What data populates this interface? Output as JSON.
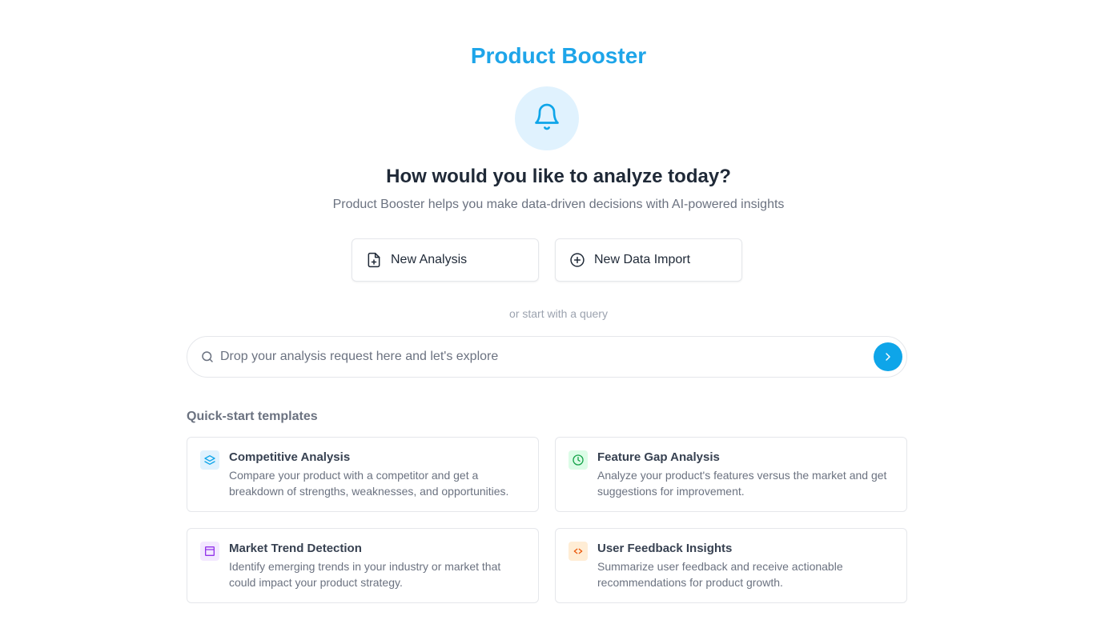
{
  "app": {
    "title": "Product Booster",
    "brand_color": "#1ea5e9"
  },
  "hero": {
    "icon": "bell-icon",
    "headline": "How would you like to analyze today?",
    "subtitle": "Product Booster helps you make data-driven decisions with AI-powered insights"
  },
  "actions": [
    {
      "label": "New Analysis",
      "icon": "file-plus-icon"
    },
    {
      "label": "New Data Import",
      "icon": "plus-circle-icon"
    }
  ],
  "divider_text": "or start with a query",
  "search": {
    "placeholder": "Drop your analysis request here and let's explore",
    "value": "",
    "icon": "search-icon",
    "submit_icon": "chevron-right-icon",
    "submit_color": "#0ea5e9"
  },
  "templates_section": {
    "label": "Quick-start templates",
    "items": [
      {
        "title": "Competitive Analysis",
        "description": "Compare your product with a competitor and get a breakdown of strengths, weaknesses, and opportunities.",
        "icon": "layers-icon",
        "icon_color": "#0ea5e9",
        "icon_bg": "#e0f2fe"
      },
      {
        "title": "Feature Gap Analysis",
        "description": "Analyze your product's features versus the market and get suggestions for improvement.",
        "icon": "clock-icon",
        "icon_color": "#16a34a",
        "icon_bg": "#dcfce7"
      },
      {
        "title": "Market Trend Detection",
        "description": "Identify emerging trends in your industry or market that could impact your product strategy.",
        "icon": "layout-icon",
        "icon_color": "#9333ea",
        "icon_bg": "#f3e8ff"
      },
      {
        "title": "User Feedback Insights",
        "description": "Summarize user feedback and receive actionable recommendations for product growth.",
        "icon": "code-icon",
        "icon_color": "#ea580c",
        "icon_bg": "#ffedd5"
      }
    ]
  }
}
